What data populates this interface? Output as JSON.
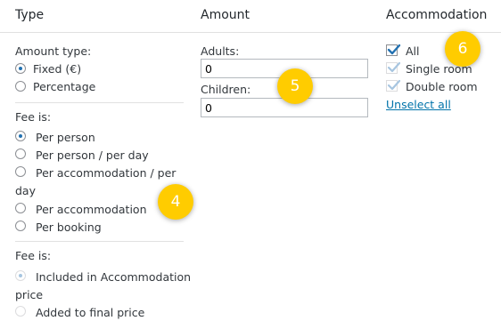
{
  "header": {
    "type": "Type",
    "amount": "Amount",
    "accommodation": "Accommodation"
  },
  "type_col": {
    "amount_type_label": "Amount type:",
    "amount_type_options": [
      "Fixed (€)",
      "Percentage"
    ],
    "fee_is_label": "Fee is:",
    "fee_options": [
      "Per person",
      "Per person / per day",
      "Per accommodation / per",
      "day",
      "Per accommodation",
      "Per booking"
    ],
    "fee_is_label_2": "Fee is:",
    "price_options": [
      "Included in Accommodation",
      "price",
      "Added to final price"
    ]
  },
  "amount_col": {
    "adults_label": "Adults:",
    "adults_value": "0",
    "children_label": "Children:",
    "children_value": "0"
  },
  "accommodation_col": {
    "items": [
      "All",
      "Single room",
      "Double room"
    ],
    "unselect_all": "Unselect all"
  },
  "badges": [
    "4",
    "5",
    "6"
  ],
  "colors": {
    "badge": "#ffcc00",
    "link": "#0073aa",
    "accent": "#2271b1"
  }
}
